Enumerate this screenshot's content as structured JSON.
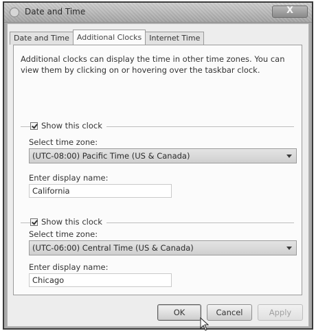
{
  "window": {
    "title": "Date and Time",
    "close_label": "X"
  },
  "tabs": [
    {
      "label": "Date and Time",
      "active": false
    },
    {
      "label": "Additional Clocks",
      "active": true
    },
    {
      "label": "Internet Time",
      "active": false
    }
  ],
  "description": "Additional clocks can display the time in other time zones. You can view them by clicking on or hovering over the taskbar clock.",
  "clocks": [
    {
      "show_label": "Show this clock",
      "show_checked": true,
      "timezone_label": "Select time zone:",
      "timezone_value": "(UTC-08:00) Pacific Time (US & Canada)",
      "display_name_label": "Enter display name:",
      "display_name_value": "California"
    },
    {
      "show_label": "Show this clock",
      "show_checked": true,
      "timezone_label": "Select time zone:",
      "timezone_value": "(UTC-06:00) Central Time (US & Canada)",
      "display_name_label": "Enter display name:",
      "display_name_value": "Chicago"
    }
  ],
  "buttons": {
    "ok": "OK",
    "cancel": "Cancel",
    "apply": "Apply"
  },
  "icons": {
    "window": "clock-icon",
    "close": "close-icon",
    "dropdown": "chevron-down-icon",
    "cursor": "mouse-pointer-icon"
  },
  "colors": {
    "frame": "#a9a9a9",
    "panel": "#fbfbfb",
    "select_fill": "#d8d8d8"
  }
}
